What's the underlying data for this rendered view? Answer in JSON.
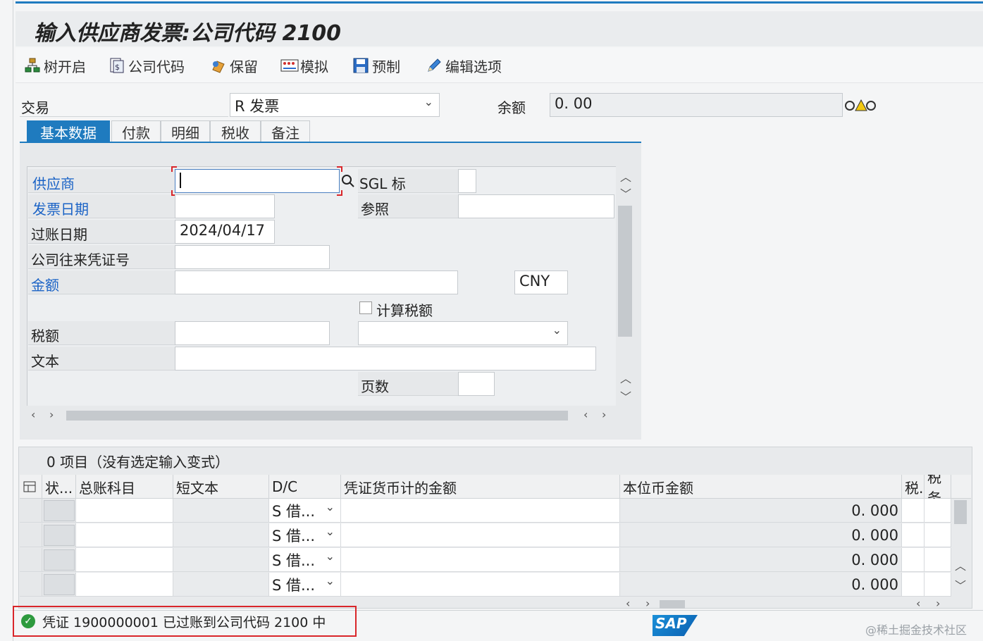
{
  "title": "输入供应商发票:公司代码 2100",
  "toolbar": {
    "tree": "树开启",
    "company_code": "公司代码",
    "hold": "保留",
    "simulate": "模拟",
    "park": "预制",
    "edit_options": "编辑选项"
  },
  "transaction": {
    "label": "交易",
    "value": "R 发票"
  },
  "balance": {
    "label": "余额",
    "value": "0. 00"
  },
  "tabs": [
    "基本数据",
    "付款",
    "明细",
    "税收",
    "备注"
  ],
  "form": {
    "vendor_label": "供应商",
    "vendor_value": "",
    "sgl_label": "SGL 标",
    "invoice_date_label": "发票日期",
    "reference_label": "参照",
    "posting_date_label": "过账日期",
    "posting_date_value": "2024/04/17",
    "cross_cc_label": "公司往来凭证号",
    "amount_label": "金额",
    "currency": "CNY",
    "calc_tax_label": "计算税额",
    "tax_label": "税额",
    "text_label": "文本",
    "pages_label": "页数"
  },
  "items_header": "0 项目（没有选定输入变式）",
  "table": {
    "columns": [
      "状...",
      "总账科目",
      "短文本",
      "D/C",
      "凭证货币计的金额",
      "本位币金额",
      "税.",
      "税务"
    ],
    "rows": [
      {
        "dc": "S 借...",
        "local_amount": "0. 000"
      },
      {
        "dc": "S 借...",
        "local_amount": "0. 000"
      },
      {
        "dc": "S 借...",
        "local_amount": "0. 000"
      },
      {
        "dc": "S 借...",
        "local_amount": "0. 000"
      }
    ]
  },
  "status": {
    "message": "凭证 1900000001 已过账到公司代码 2100 中"
  },
  "footer": {
    "logo": "SAP",
    "watermark": "@稀土掘金技术社区"
  }
}
